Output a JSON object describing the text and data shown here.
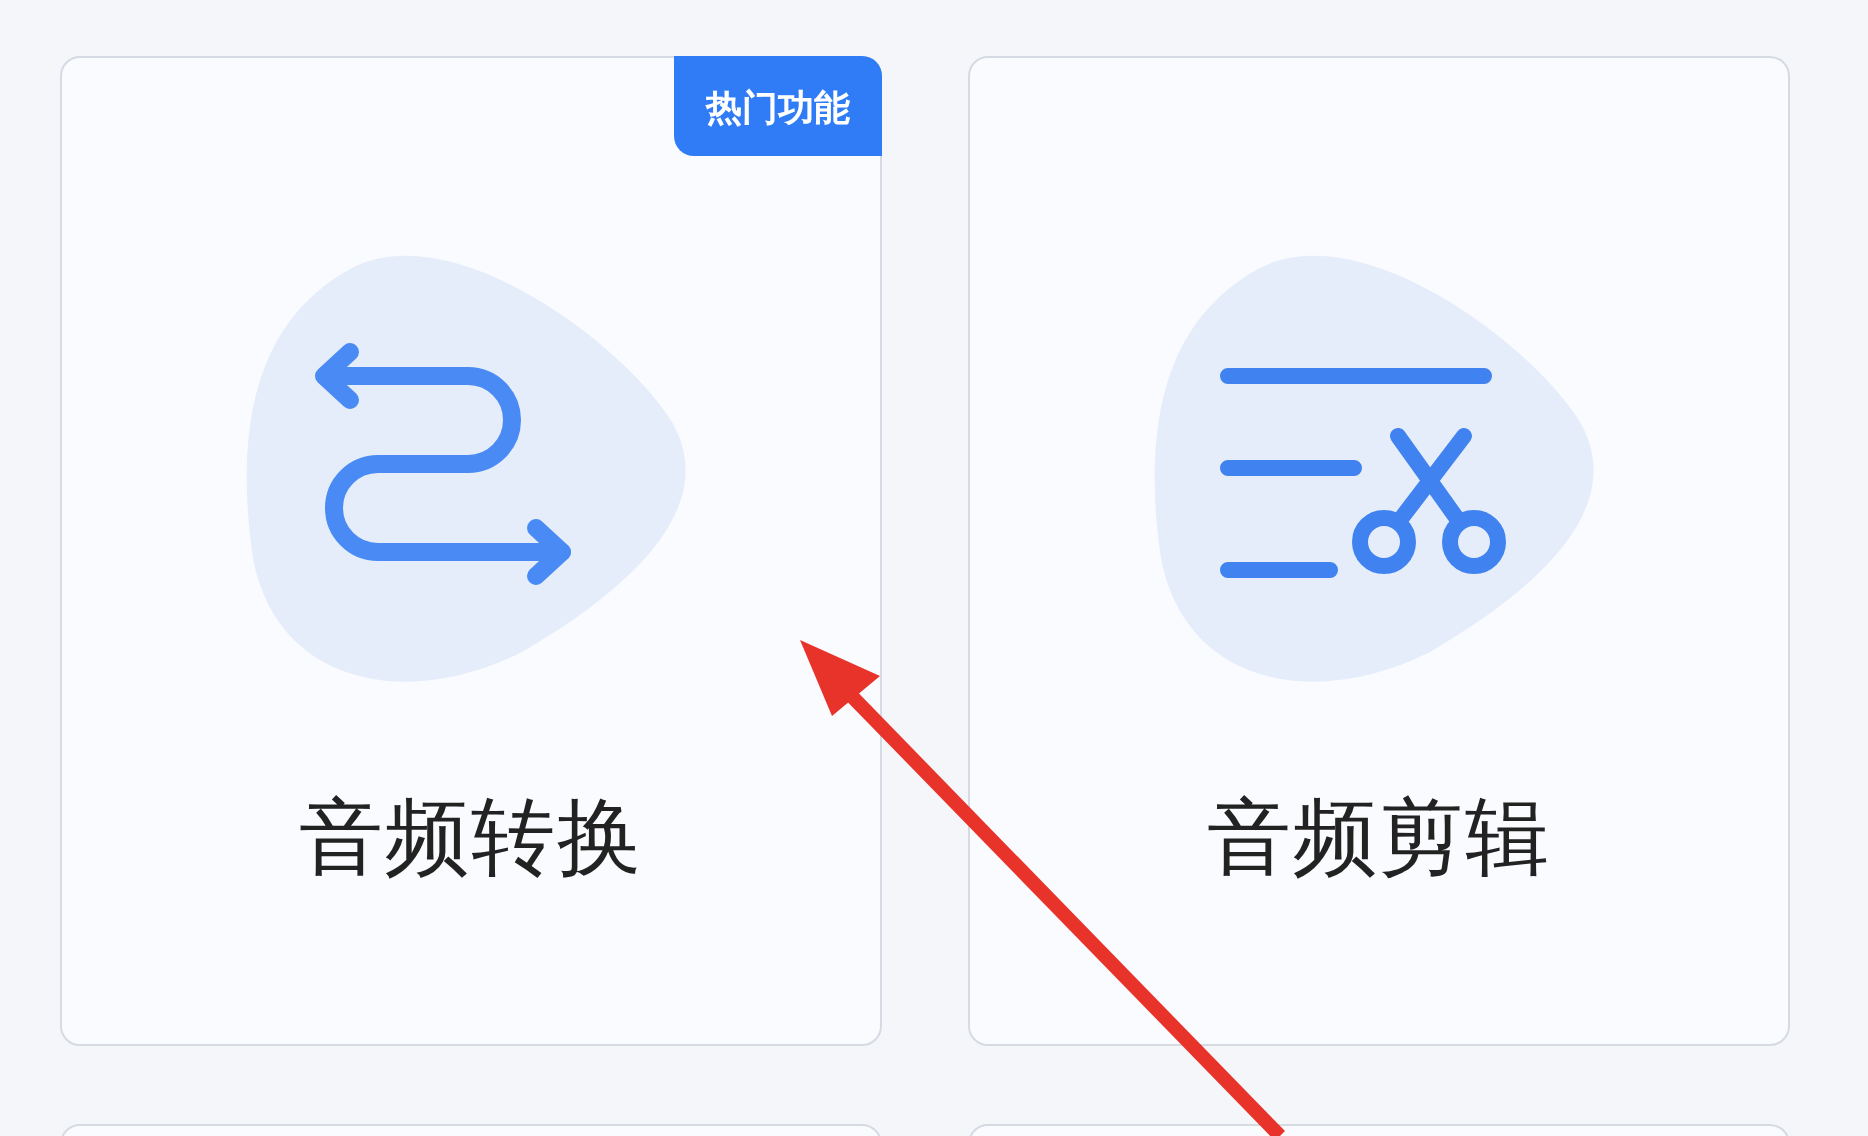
{
  "cards": [
    {
      "title": "音频转换",
      "kind": "convert",
      "badge": "热门功能"
    },
    {
      "title": "音频剪辑",
      "kind": "edit"
    }
  ]
}
